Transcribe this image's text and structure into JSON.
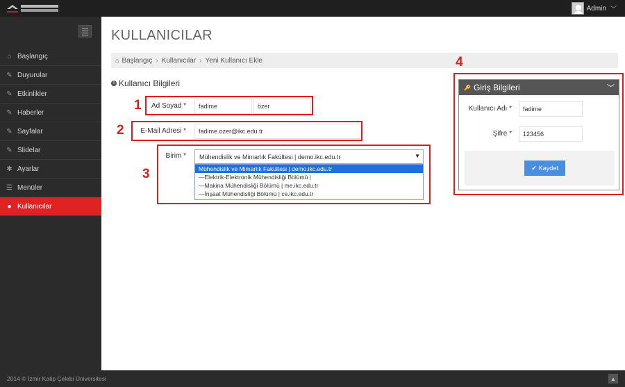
{
  "header": {
    "logo_text": "İZMİR KATİP ÇELEBİ ÜNİVERSİTESİ",
    "user": "Admin"
  },
  "sidebar": {
    "items": [
      {
        "label": "Başlangıç",
        "icon": "home-icon"
      },
      {
        "label": "Duyurular",
        "icon": "edit-icon"
      },
      {
        "label": "Etkinlikler",
        "icon": "edit-icon"
      },
      {
        "label": "Haberler",
        "icon": "edit-icon"
      },
      {
        "label": "Sayfalar",
        "icon": "edit-icon"
      },
      {
        "label": "Slidelar",
        "icon": "edit-icon"
      },
      {
        "label": "Ayarlar",
        "icon": "gear-icon"
      },
      {
        "label": "Menüler",
        "icon": "list-icon"
      },
      {
        "label": "Kullanıcılar",
        "icon": "user-icon",
        "active": true
      }
    ]
  },
  "page": {
    "title": "KULLANICILAR",
    "breadcrumb": [
      "Başlangıç",
      "Kullanıcılar",
      "Yeni Kullanıcı Ekle"
    ]
  },
  "form": {
    "section_title": "Kullanıcı Bilgileri",
    "name_label": "Ad Soyad *",
    "first_name": "fadime",
    "last_name": "özer",
    "email_label": "E-Mail Adresi *",
    "email": "fadime.ozer@ikc.edu.tr",
    "unit_label": "Birim *",
    "unit_selected": "Mühendislik ve Mimarlık Fakültesi | demo.ikc.edu.tr",
    "unit_options": [
      "Mühendislik ve Mimarlık Fakültesi | demo.ikc.edu.tr",
      "—Elektrik-Elektronik Mühendisliği Bölümü |",
      "—Makina Mühendisliği Bölümü | me.ikc.edu.tr",
      "—İnşaat Mühendisliği Bölümü | ce.ikc.edu.tr"
    ]
  },
  "login_panel": {
    "title": "Giriş Bilgileri",
    "username_label": "Kullanıcı Adı *",
    "username": "fadime",
    "password_label": "Şifre *",
    "password": "123456",
    "save_label": "Kaydet"
  },
  "annotations": {
    "n1": "1",
    "n2": "2",
    "n3": "3",
    "n4": "4"
  },
  "footer": {
    "text": "2014 © İzmir Katip Çelebi Üniversitesi"
  },
  "colors": {
    "accent": "#e02222",
    "annotation": "#e01b1b",
    "button": "#4a8ee0",
    "selected_option": "#1e6fe0"
  }
}
